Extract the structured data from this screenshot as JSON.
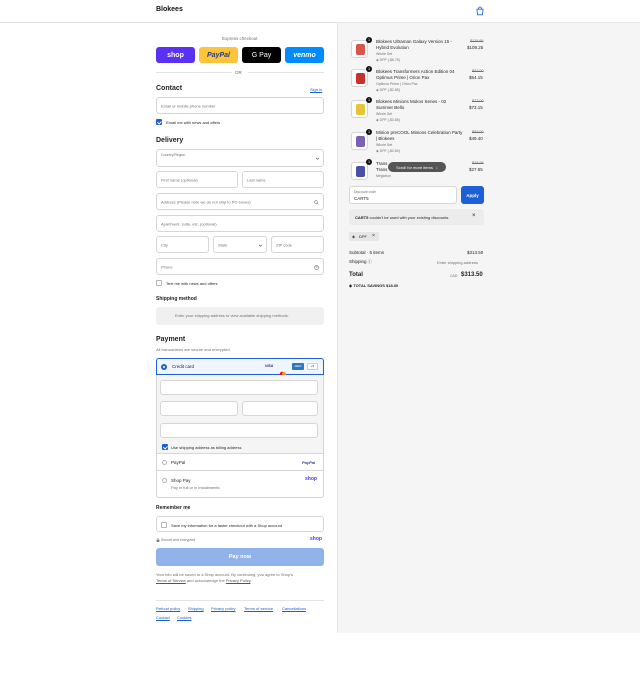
{
  "header": {
    "brand": "Blokees",
    "cart_icon": "shopping-bag-icon"
  },
  "express": {
    "title": "Express checkout",
    "buttons": [
      {
        "label": "shop",
        "color": "#5a31f4"
      },
      {
        "label": "PayPal",
        "color": "#ffc439"
      },
      {
        "label": "G Pay",
        "color": "#000000"
      },
      {
        "label": "venmo",
        "color": "#008cff"
      }
    ],
    "or": "OR"
  },
  "contact": {
    "title": "Contact",
    "sign_in": "Sign in",
    "email_placeholder": "Email or mobile phone number",
    "news_label": "Email me with news and offers",
    "news_checked": true
  },
  "delivery": {
    "title": "Delivery",
    "country_label": "Country/Region",
    "first_name": "First name (optional)",
    "last_name": "Last name",
    "address": "Address (Please note we do not ship to PO boxes)",
    "apartment": "Apartment, suite, etc. (optional)",
    "city": "City",
    "state": "State",
    "zip": "ZIP code",
    "phone": "Phone",
    "text_label": "Text me with news and offers",
    "text_checked": false
  },
  "shipping_method": {
    "title": "Shipping method",
    "notice": "Enter your shipping address to view available shipping methods."
  },
  "payment": {
    "title": "Payment",
    "subtitle": "All transactions are secure and encrypted.",
    "credit_card": "Credit card",
    "card_brands": [
      "VISA",
      "MC",
      "AMEX",
      "+5"
    ],
    "billing_label": "Use shipping address as billing address",
    "paypal": "PayPal",
    "paypal_logo": "PayPal",
    "shop_pay": "Shop Pay",
    "shop_pay_sub": "Pay in full or in installments",
    "shop_pay_logo": "shop"
  },
  "remember": {
    "title": "Remember me",
    "save_label": "Save my information for a faster checkout with a Shop account",
    "secure": "Secure and encrypted",
    "shop_logo": "shop"
  },
  "pay_now": "Pay now",
  "legal": {
    "line1": "Your info will be saved to a Shop account. By continuing, you agree to Shop's",
    "terms": "Terms of Service",
    "and": " and acknowledge the ",
    "privacy": "Privacy Policy",
    "dot": "."
  },
  "footer_links": [
    "Refund policy",
    "Shipping",
    "Privacy policy",
    "Terms of service",
    "Cancellations",
    "Contact",
    "Cookies"
  ],
  "cart": {
    "items": [
      {
        "qty": "1",
        "name1": "Blokees Ultraman Galaxy Version 15 -",
        "name2": "Hybrid Evolution",
        "variant": "Whole Set",
        "discount": "DPF (-$6.75)",
        "old_price": "$115.95",
        "price": "$109.25",
        "color": "#d9544a"
      },
      {
        "qty": "1",
        "name1": "Blokees Transformers Action Edition 04",
        "name2": "Optimus Prime | Orion Pax",
        "variant": "Optimus Prime | Orion Pax",
        "discount": "DPF (-$2.85)",
        "old_price": "$57.00",
        "price": "$54.15",
        "color": "#c7302b"
      },
      {
        "qty": "1",
        "name1": "Blokees Minions Mokos Series - 02",
        "name2": "Summer Bello",
        "variant": "Whole Set",
        "discount": "DPF (-$3.85)",
        "old_price": "$77.00",
        "price": "$73.15",
        "color": "#e7c534"
      },
      {
        "qty": "1",
        "name1": "Minion preCOOL Minions Celebration Party",
        "name2": "| Blokees",
        "variant": "Whole Set",
        "discount": "DPF (-$2.60)",
        "old_price": "$52.00",
        "price": "$49.40",
        "color": "#7a5fb8"
      },
      {
        "qty": "1",
        "name1": "Trans",
        "name2": "Trans",
        "variant": "Megatron",
        "discount": "",
        "old_price": "$28.95",
        "price": "$27.55",
        "color": "#4b4fa8"
      }
    ],
    "scroll_hint": "Scroll for more items",
    "discount_label": "Discount code",
    "discount_value": "CART5",
    "apply": "Apply",
    "error_code": "CART5",
    "error_text": " couldn't be used with your existing discounts.",
    "tag": "DPF",
    "subtotal_label": "Subtotal · 5 items",
    "subtotal_value": "$313.50",
    "shipping_label": "Shipping",
    "shipping_value": "Enter shipping address",
    "total_label": "Total",
    "currency": "CAD",
    "total_value": "$313.50",
    "savings_label": "TOTAL SAVINGS",
    "savings_value": "$18.00"
  }
}
